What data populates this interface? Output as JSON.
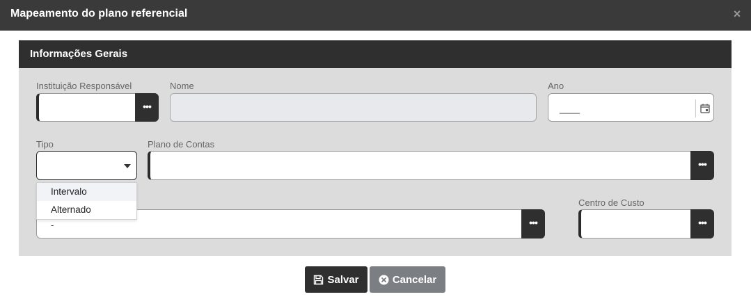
{
  "modal": {
    "title": "Mapeamento do plano referencial",
    "close_symbol": "×"
  },
  "panel": {
    "title": "Informações Gerais"
  },
  "fields": {
    "instituicao": {
      "label": "Instituição Responsável",
      "value": "",
      "button": "•••"
    },
    "nome": {
      "label": "Nome",
      "value": ""
    },
    "ano": {
      "label": "Ano",
      "mask": "____"
    },
    "tipo": {
      "label": "Tipo",
      "value": ""
    },
    "plano_contas": {
      "label": "Plano de Contas",
      "value": "",
      "button": "•••"
    },
    "conta": {
      "value": "-",
      "button": "•••"
    },
    "centro_custo": {
      "label": "Centro de Custo",
      "value": "",
      "button": "•••"
    }
  },
  "tipo_options": [
    "Intervalo",
    "Alternado"
  ],
  "actions": {
    "save_label": "Salvar",
    "cancel_label": "Cancelar"
  },
  "colors": {
    "header": "#3a3a3a",
    "panel_header": "#2f2f2f",
    "panel_bg": "#dcdcdc",
    "cancel": "#7b7f84"
  }
}
